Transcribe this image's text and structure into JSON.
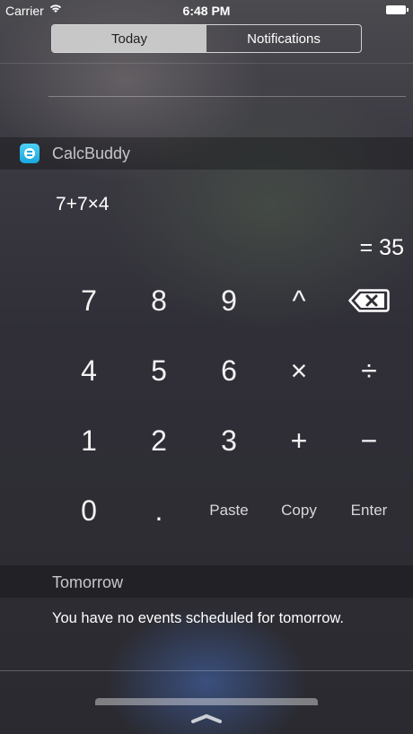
{
  "status_bar": {
    "carrier": "Carrier",
    "time": "6:48 PM"
  },
  "tabs": [
    {
      "label": "Today"
    },
    {
      "label": "Notifications"
    }
  ],
  "widget": {
    "app_name": "CalcBuddy",
    "expression": "7+7×4",
    "result": "= 35",
    "keys": {
      "k7": "7",
      "k8": "8",
      "k9": "9",
      "power": "^",
      "k4": "4",
      "k5": "5",
      "k6": "6",
      "multiply": "×",
      "divide": "÷",
      "k1": "1",
      "k2": "2",
      "k3": "3",
      "plus": "+",
      "minus": "−",
      "k0": "0",
      "dot": ".",
      "paste": "Paste",
      "copy": "Copy",
      "enter": "Enter"
    }
  },
  "tomorrow": {
    "title": "Tomorrow",
    "message": "You have no events scheduled for tomorrow."
  },
  "icons": {
    "wifi": "wifi-icon",
    "battery": "battery-icon",
    "backspace": "backspace-icon",
    "app": "calcbuddy-app-icon",
    "chevron": "chevron-up-icon"
  },
  "colors": {
    "accent": "#17a6dc",
    "segment_active_bg": "#dcdcdc"
  }
}
